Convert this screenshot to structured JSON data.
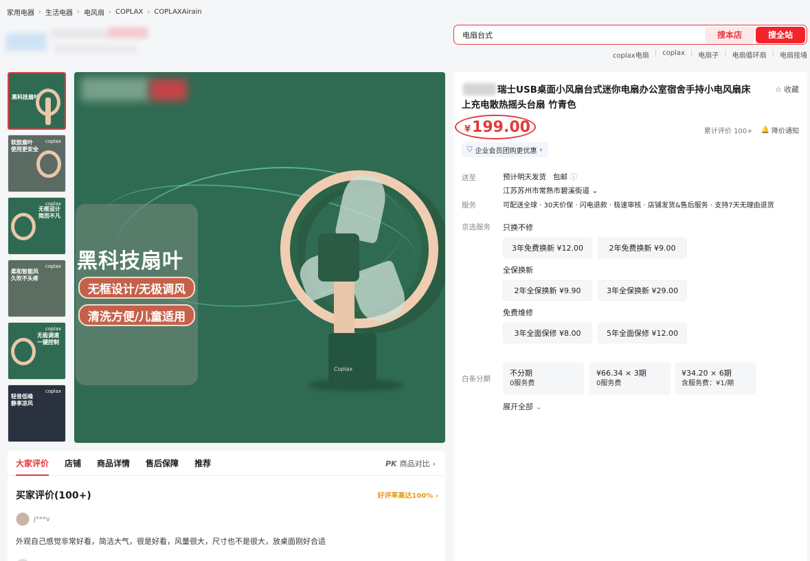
{
  "breadcrumb": [
    "家用电器",
    "生活电器",
    "电风扇",
    "COPLAX",
    "COPLAXAirain"
  ],
  "search": {
    "value": "电扇台式",
    "store_button": "搜本店",
    "all_button": "搜全站",
    "hot_words": [
      "coplax电扇",
      "coplax",
      "电扇子",
      "电扇循环扇",
      "电扇挂墙"
    ]
  },
  "thumbnails": [
    {
      "label": "黑科技扇叶"
    },
    {
      "brand": "coplax",
      "label": "软胶扇叶 使用更安全"
    },
    {
      "brand": "coplax",
      "label": "无框设计 简而不凡"
    },
    {
      "brand": "coplax",
      "label": "柔和智能风 久吹不头疼"
    },
    {
      "brand": "coplax",
      "label": "无极调速 一键控制"
    },
    {
      "brand": "coplax",
      "label": "轻音低噪 静享凉风"
    }
  ],
  "main_image": {
    "headline": "黑科技扇叶",
    "pill1": "无框设计/无极调风",
    "pill2": "清洗方便/儿童适用",
    "logo": "Coplax"
  },
  "tabs": {
    "items": [
      "大家评价",
      "店铺",
      "商品详情",
      "售后保障",
      "推荐"
    ],
    "pk_badge": "PK",
    "compare": "商品对比"
  },
  "reviews": {
    "title": "买家评价(100+)",
    "good_rate": "好评率高达100%",
    "first": {
      "user": "j***v",
      "text": "外观自己感觉非常好看，简洁大气，很是好看，风量很大，尺寸也不是很大，放桌面刚好合适"
    }
  },
  "product": {
    "title": "瑞士USB桌面小风扇台式迷你电扇办公室宿舍手持小电风扇床上充电散热摇头台扇 竹青色",
    "favorite": "收藏",
    "currency": "¥",
    "price": "199.00",
    "review_count": "累计评价 100+",
    "price_notice": "降价通知",
    "coupon": "企业会员团购更优惠"
  },
  "delivery": {
    "label": "送至",
    "eta": "预计明天发货",
    "shipping": "包邮",
    "address": "江苏苏州市常熟市碧溪街道"
  },
  "service": {
    "label": "服务",
    "text": "可配送全球 · 30天价保 · 闪电退款 · 极速审核 · 店铺发货&售后服务 · 支持7天无理由退货"
  },
  "jd_service": {
    "label": "京选服务",
    "groups": [
      {
        "name": "只换不修",
        "options": [
          "3年免费换新 ¥12.00",
          "2年免费换新 ¥9.00"
        ]
      },
      {
        "name": "全保换新",
        "options": [
          "2年全保换新 ¥9.90",
          "3年全保换新 ¥29.00"
        ]
      },
      {
        "name": "免费维修",
        "options": [
          "3年全面保修 ¥8.00",
          "5年全面保修 ¥12.00"
        ]
      }
    ]
  },
  "installment": {
    "label": "白条分期",
    "plans": [
      {
        "title": "不分期",
        "fee": "0服务费"
      },
      {
        "title": "¥66.34 × 3期",
        "fee": "0服务费"
      },
      {
        "title": "¥34.20 × 6期",
        "fee": "含服务费：¥1/期"
      }
    ],
    "expand": "展开全部"
  },
  "colors": {
    "accent": "#e4393c",
    "thumb_green": "#2f6b52"
  }
}
